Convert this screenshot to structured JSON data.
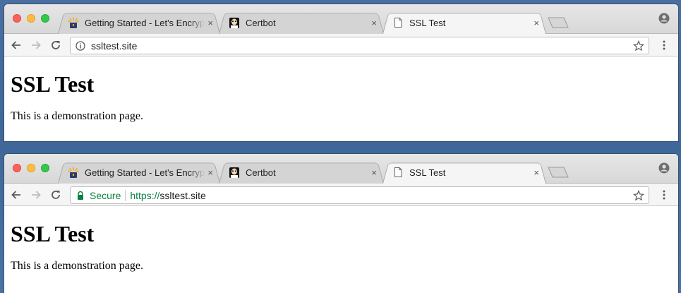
{
  "windows": [
    {
      "tabs": [
        {
          "title": "Getting Started - Let's Encrypt",
          "icon": "lets-encrypt-icon",
          "active": false,
          "close": "×"
        },
        {
          "title": "Certbot",
          "icon": "certbot-icon",
          "active": false,
          "close": "×"
        },
        {
          "title": "SSL Test",
          "icon": "page-icon",
          "active": true,
          "close": "×"
        }
      ],
      "omnibox": {
        "security_icon": "info-icon",
        "url": "ssltest.site"
      },
      "page": {
        "heading": "SSL Test",
        "text": "This is a demonstration page."
      }
    },
    {
      "tabs": [
        {
          "title": "Getting Started - Let's Encrypt",
          "icon": "lets-encrypt-icon",
          "active": false,
          "close": "×"
        },
        {
          "title": "Certbot",
          "icon": "certbot-icon",
          "active": false,
          "close": "×"
        },
        {
          "title": "SSL Test",
          "icon": "page-icon",
          "active": true,
          "close": "×"
        }
      ],
      "omnibox": {
        "security_icon": "lock-icon",
        "secure_label": "Secure",
        "url_scheme": "https://",
        "url_host": "ssltest.site"
      },
      "page": {
        "heading": "SSL Test",
        "text": "This is a demonstration page."
      }
    }
  ],
  "colors": {
    "desktop": "#4a6ea0",
    "secure_green": "#0b8043",
    "traffic_red": "#fc605b",
    "traffic_yellow": "#fdbc40",
    "traffic_green": "#34c84a"
  }
}
